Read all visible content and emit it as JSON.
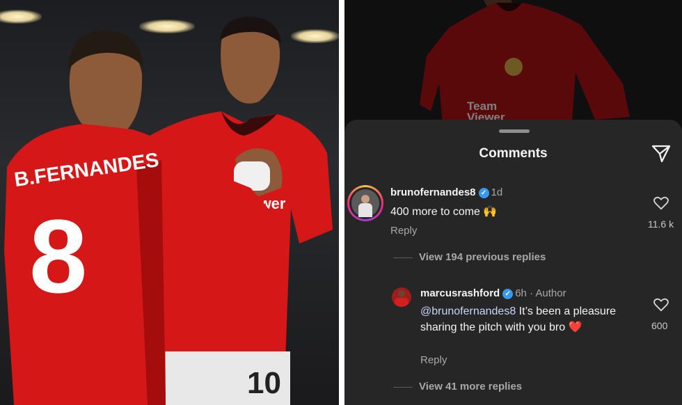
{
  "photo": {
    "left_player": {
      "name_on_shirt": "B.FERNANDES",
      "number": "8"
    },
    "right_player": {
      "number": "10",
      "sponsor": "Team Viewer"
    }
  },
  "sheet": {
    "title": "Comments",
    "send_icon": "send-icon",
    "comments": [
      {
        "username": "brunofernandes8",
        "verified": true,
        "time": "1d",
        "text": "400 more to come 🙌",
        "reply_label": "Reply",
        "like_count": "11.6 k"
      },
      {
        "username": "marcusrashford",
        "verified": true,
        "time": "6h",
        "author_label": "Author",
        "mention": "@brunofernandes8",
        "text": " It’s been a pleasure sharing the pitch with you bro ❤️",
        "reply_label": "Reply",
        "like_count": "600"
      }
    ],
    "view_previous": "View 194 previous replies",
    "view_more": "View 41 more replies"
  }
}
